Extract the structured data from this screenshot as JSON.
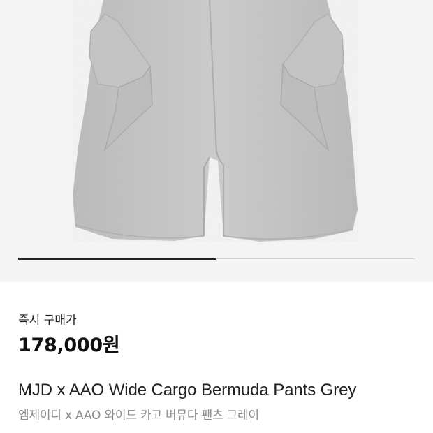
{
  "product": {
    "image_alt": "MJD x AAO Wide Cargo Bermuda Pants Grey",
    "price_label": "즉시 구매가",
    "price": "178,000원",
    "title_en": "MJD x AAO Wide Cargo Bermuda Pants Grey",
    "title_ko": "엠제이디 x AAO 와이드 카고 버뮤다 팬츠 그레이"
  },
  "gallery": {
    "current_slide": 1,
    "total_slides": 2
  },
  "colors": {
    "gallery_bg": "#f4f4f4",
    "garment": "#c9c9c9",
    "indicator_active": "#222222",
    "indicator_track": "#cfcfcf"
  }
}
